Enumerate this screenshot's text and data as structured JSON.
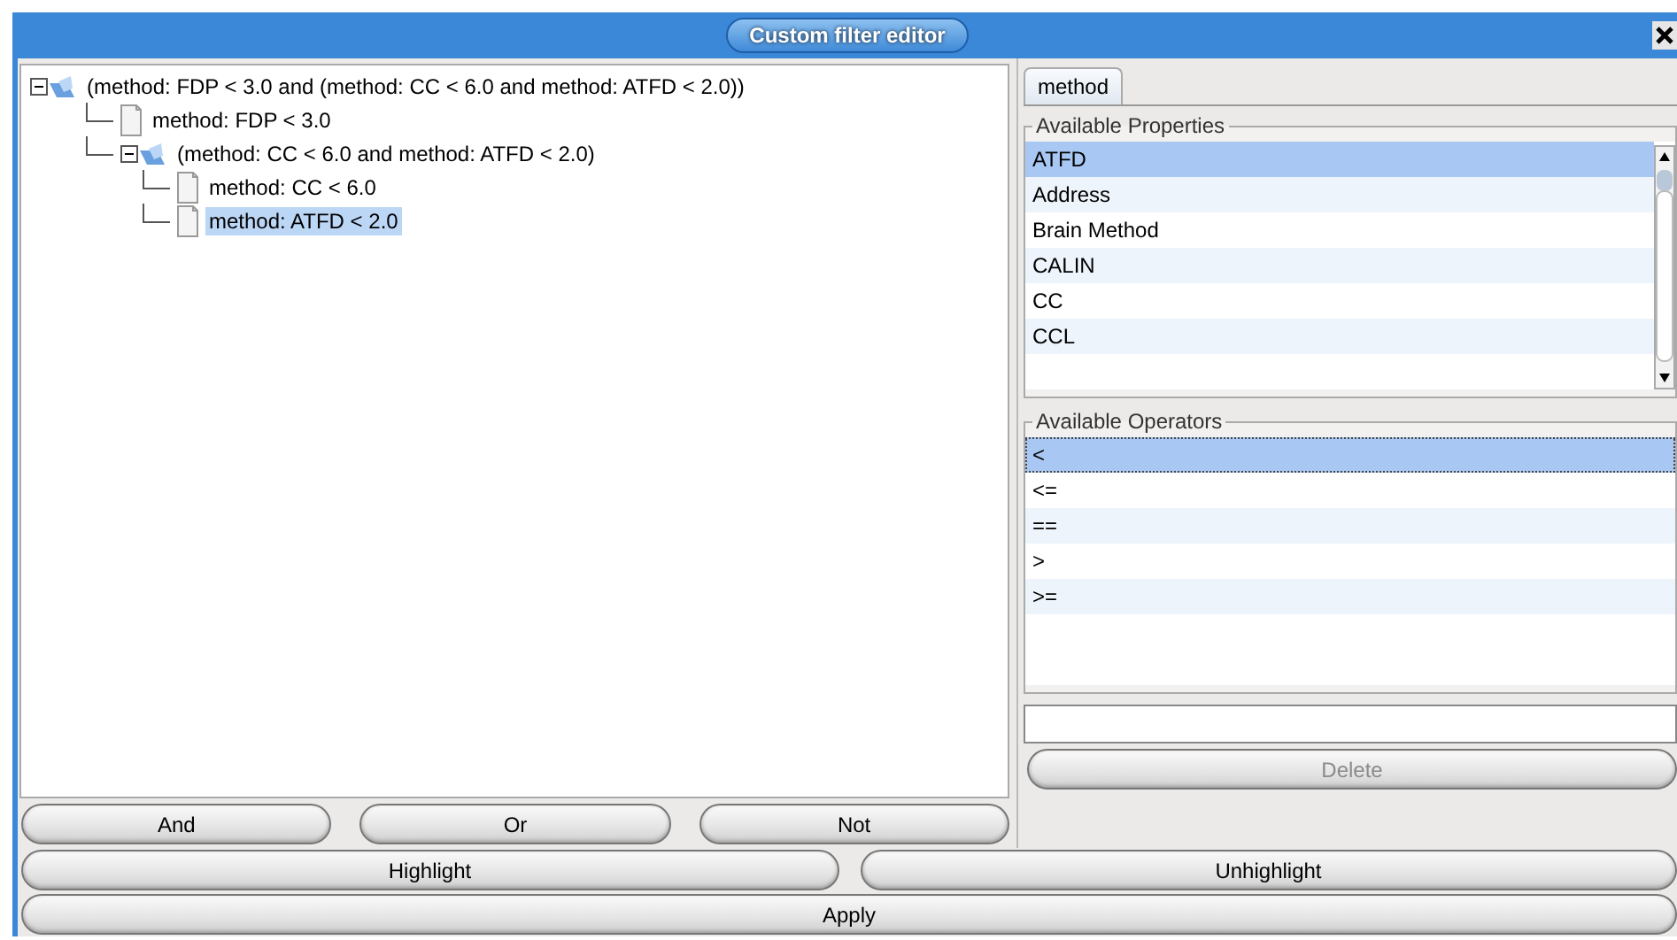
{
  "window": {
    "title": "Custom filter editor"
  },
  "tree": [
    {
      "kind": "group",
      "label": "(method: FDP < 3.0 and (method: CC < 6.0 and method: ATFD < 2.0))",
      "expanded": true,
      "selected": false,
      "children": [
        {
          "kind": "leaf",
          "label": "method: FDP < 3.0",
          "selected": false
        },
        {
          "kind": "group",
          "label": "(method: CC < 6.0 and method: ATFD < 2.0)",
          "expanded": true,
          "selected": false,
          "children": [
            {
              "kind": "leaf",
              "label": "method: CC < 6.0",
              "selected": false
            },
            {
              "kind": "leaf",
              "label": "method: ATFD < 2.0",
              "selected": true
            }
          ]
        }
      ]
    }
  ],
  "tabs": [
    {
      "label": "method",
      "selected": true
    }
  ],
  "properties": {
    "title": "Available Properties",
    "items": [
      {
        "label": "ATFD",
        "selected": true
      },
      {
        "label": "Address",
        "selected": false
      },
      {
        "label": "Brain Method",
        "selected": false
      },
      {
        "label": "CALIN",
        "selected": false
      },
      {
        "label": "CC",
        "selected": false
      },
      {
        "label": "CCL",
        "selected": false
      }
    ]
  },
  "operators": {
    "title": "Available Operators",
    "items": [
      {
        "label": "<",
        "selected": true
      },
      {
        "label": "<=",
        "selected": false
      },
      {
        "label": "==",
        "selected": false
      },
      {
        "label": ">",
        "selected": false
      },
      {
        "label": ">=",
        "selected": false
      }
    ]
  },
  "logic_buttons": [
    {
      "label": "And",
      "disabled": false
    },
    {
      "label": "Or",
      "disabled": false
    },
    {
      "label": "Not",
      "disabled": false
    }
  ],
  "delete_button": {
    "label": "Delete",
    "disabled": true
  },
  "highlight_buttons": [
    {
      "label": "Highlight",
      "disabled": false
    },
    {
      "label": "Unhighlight",
      "disabled": false
    }
  ],
  "apply_button": {
    "label": "Apply",
    "disabled": false
  }
}
